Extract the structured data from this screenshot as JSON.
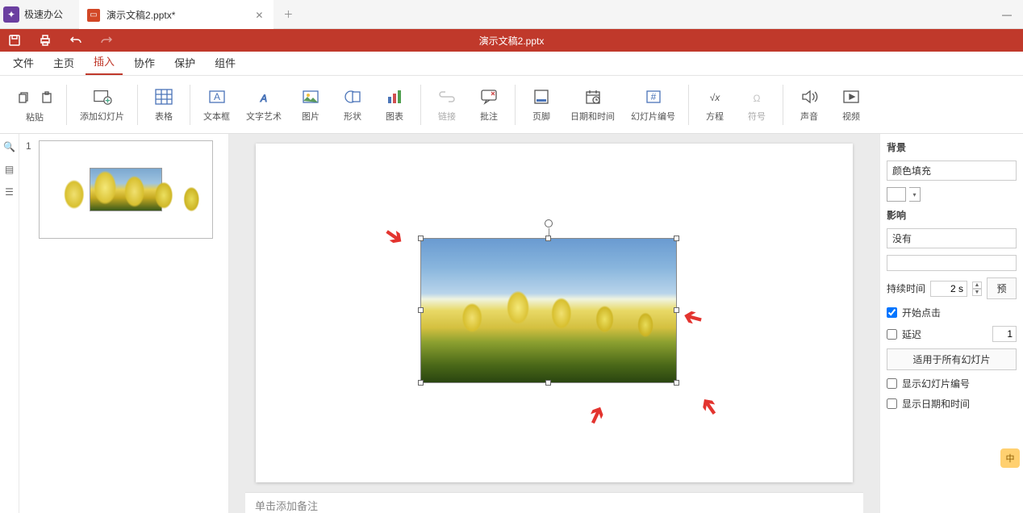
{
  "app_name": "极速办公",
  "tab": {
    "label": "演示文稿2.pptx*"
  },
  "qat_title": "演示文稿2.pptx",
  "menus": [
    "文件",
    "主页",
    "插入",
    "协作",
    "保护",
    "组件"
  ],
  "active_menu": 2,
  "ribbon": {
    "paste": "粘贴",
    "add_slide": "添加幻灯片",
    "table": "表格",
    "textbox": "文本框",
    "text_art": "文字艺术",
    "image": "图片",
    "shape": "形状",
    "chart": "图表",
    "link": "链接",
    "comment": "批注",
    "footer": "页脚",
    "datetime": "日期和时间",
    "slide_num": "幻灯片编号",
    "equation": "方程",
    "symbol": "符号",
    "sound": "声音",
    "video": "视频"
  },
  "slide_number": "1",
  "notes_hint": "单击添加备注",
  "right": {
    "bg_title": "背景",
    "bg_fill": "颜色填充",
    "effect_title": "影响",
    "effect_none": "没有",
    "duration_label": "持续时间",
    "duration_value": "2 s",
    "preview": "预",
    "start_click": "开始点击",
    "delay": "延迟",
    "delay_val": "1",
    "apply_all": "适用于所有幻灯片",
    "show_num": "显示幻灯片编号",
    "show_dt": "显示日期和时间"
  },
  "badge": "中"
}
